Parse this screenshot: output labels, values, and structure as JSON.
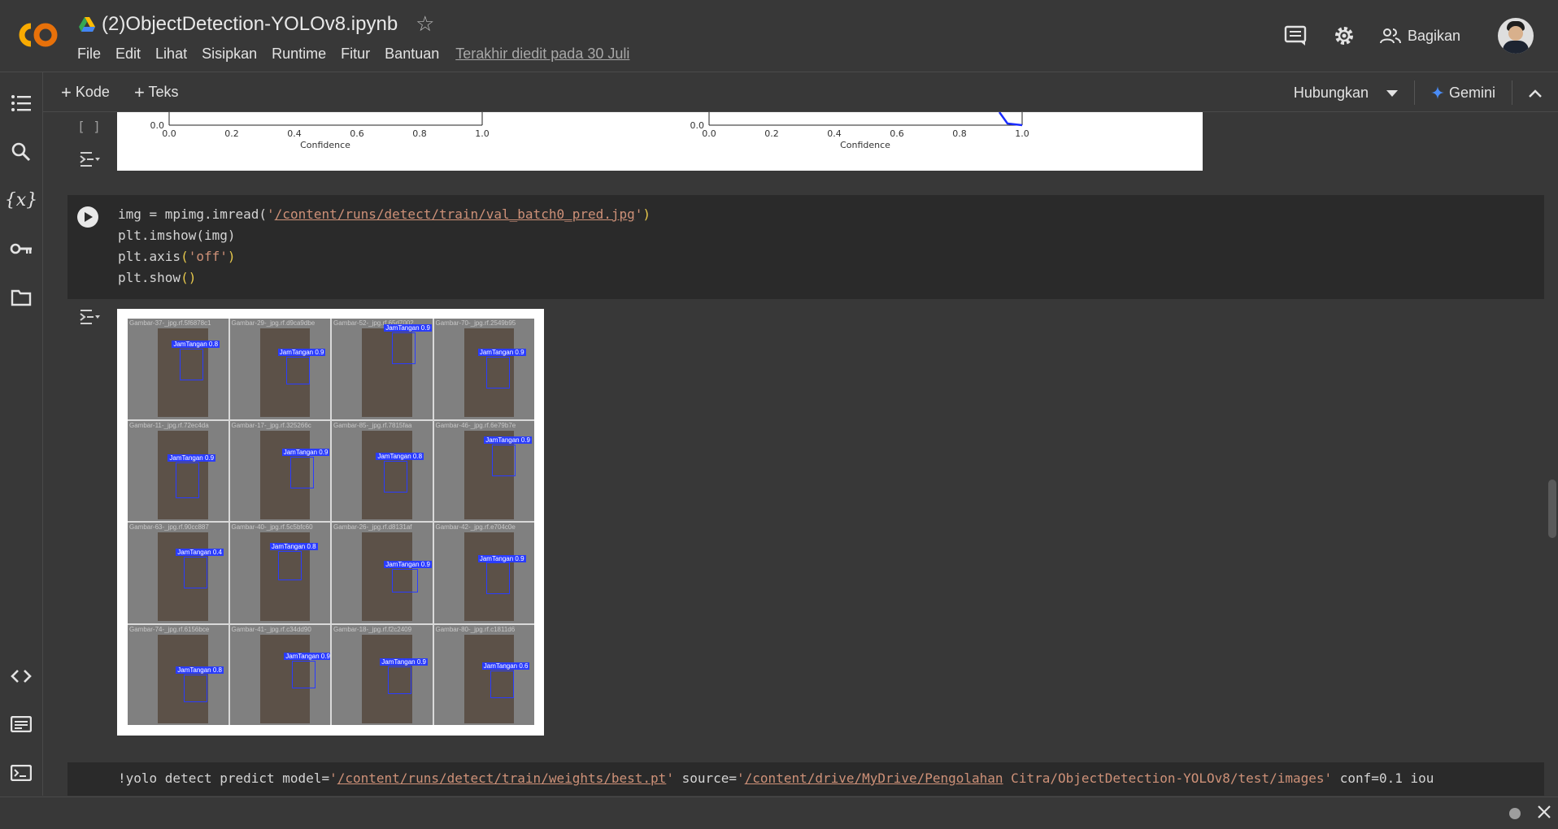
{
  "doc_title": "(2)ObjectDetection-YOLOv8.ipynb",
  "menu": [
    "File",
    "Edit",
    "Lihat",
    "Sisipkan",
    "Runtime",
    "Fitur",
    "Bantuan"
  ],
  "last_edit": "Terakhir diedit pada 30 Juli",
  "share_label": "Bagikan",
  "toolbar": {
    "add_code": "Kode",
    "add_text": "Teks",
    "connect": "Hubungkan",
    "gemini": "Gemini"
  },
  "prev_output": {
    "xlabel": "Confidence",
    "y0": "0.0",
    "ticks": [
      "0.0",
      "0.2",
      "0.4",
      "0.6",
      "0.8",
      "1.0"
    ]
  },
  "cell_brackets": "[ ]",
  "code_cell": {
    "line1_pre": "img = mpimg.imread(",
    "line1_str_q1": "'",
    "line1_path": "/content/runs/detect/train/val_batch0_pred.jpg",
    "line1_str_q2": "'",
    "line1_post": ")",
    "line2_pre": "plt.imshow",
    "line2_arg": "(img)",
    "line3_pre": "plt.axis",
    "line3_open": "(",
    "line3_str": "'off'",
    "line3_close": ")",
    "line4_pre": "plt.show",
    "line4_paren": "()"
  },
  "bottom_cell": {
    "pre": "!yolo detect predict model=",
    "q": "'",
    "model_path": "/content/runs/detect/train/weights/best.pt",
    "mid": " source=",
    "source_a": "/content/drive/MyDrive/Pengolahan",
    "source_b": " Citra/ObjectDetection-YOLOv8/test/images",
    "post": " conf=0.1 iou"
  },
  "tiles": [
    {
      "fn": "Gambar-37-_jpg.rf.5f6878c1",
      "label": "JamTangan 0.8"
    },
    {
      "fn": "Gambar-29-_jpg.rf.d9ca9dbe",
      "label": "JamTangan 0.9"
    },
    {
      "fn": "Gambar-52-_jpg.rf.65d7002",
      "label": "JamTangan 0.9"
    },
    {
      "fn": "Gambar-70-_jpg.rf.2549b95",
      "label": "JamTangan 0.9"
    },
    {
      "fn": "Gambar-11-_jpg.rf.72ec4da",
      "label": "JamTangan 0.9"
    },
    {
      "fn": "Gambar-17-_jpg.rf.325266c",
      "label": "JamTangan 0.9"
    },
    {
      "fn": "Gambar-85-_jpg.rf.7815faa",
      "label": "JamTangan 0.8"
    },
    {
      "fn": "Gambar-46-_jpg.rf.6e79b7e",
      "label": "JamTangan 0.9"
    },
    {
      "fn": "Gambar-63-_jpg.rf.90cc887",
      "label": "JamTangan 0.4"
    },
    {
      "fn": "Gambar-40-_jpg.rf.5c5bfc60",
      "label": "JamTangan 0.8"
    },
    {
      "fn": "Gambar-26-_jpg.rf.d8131af",
      "label": "JamTangan 0.9"
    },
    {
      "fn": "Gambar-42-_jpg.rf.e704c0e",
      "label": "JamTangan 0.9"
    },
    {
      "fn": "Gambar-74-_jpg.rf.6156bce",
      "label": "JamTangan 0.8"
    },
    {
      "fn": "Gambar-41-_jpg.rf.c34dd90",
      "label": "JamTangan 0.9"
    },
    {
      "fn": "Gambar-18-_jpg.rf.f2c2409",
      "label": "JamTangan 0.9"
    },
    {
      "fn": "Gambar-80-_jpg.rf.c1811d6",
      "label": "JamTangan 0.6"
    }
  ]
}
